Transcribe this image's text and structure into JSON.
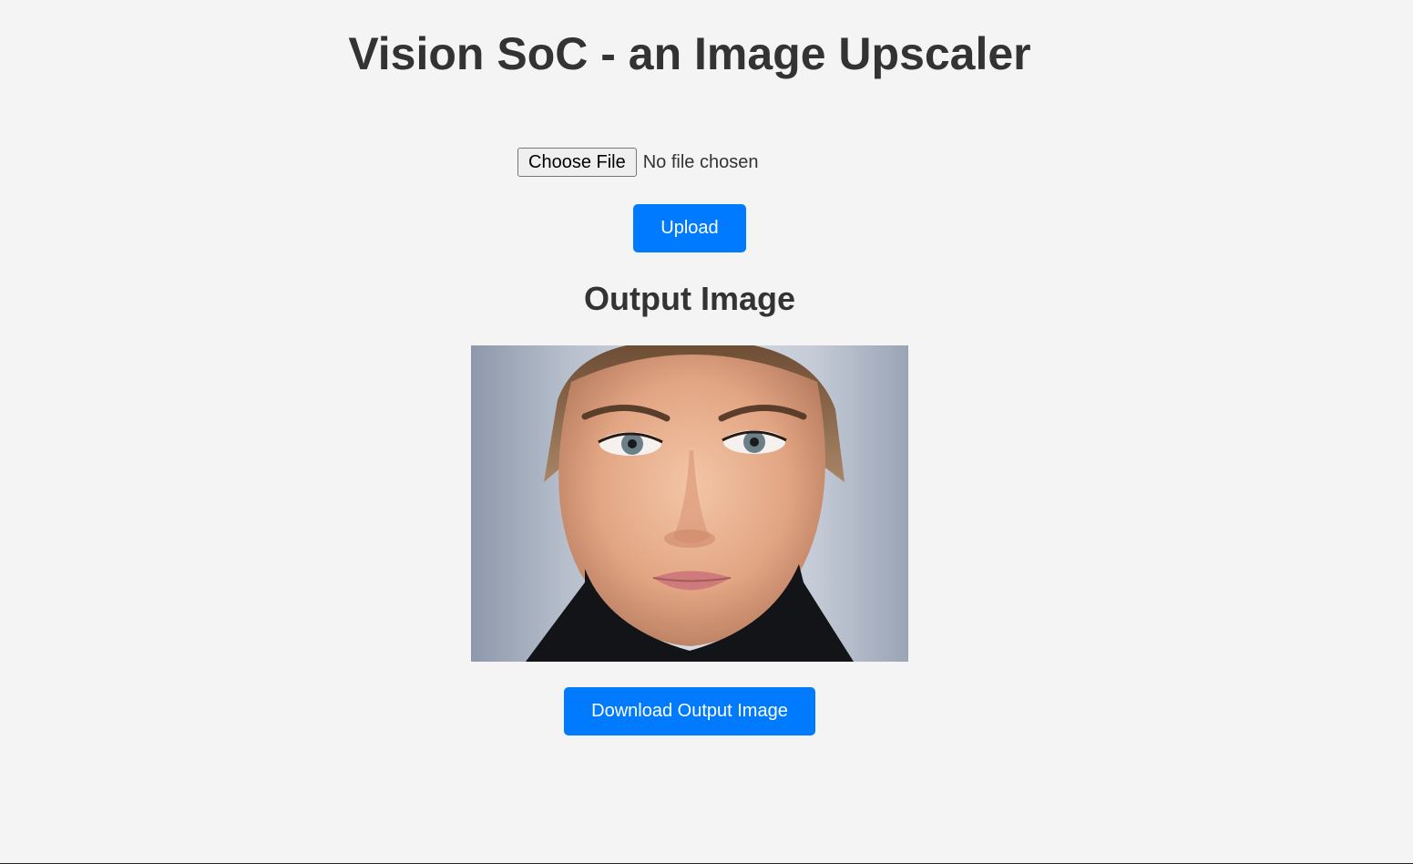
{
  "page": {
    "title": "Vision SoC - an Image Upscaler"
  },
  "upload_form": {
    "choose_file_label": "Choose File",
    "file_status": "No file chosen",
    "upload_label": "Upload"
  },
  "output": {
    "heading": "Output Image",
    "image_alt": "Upscaled output image",
    "download_label": "Download Output Image"
  },
  "colors": {
    "background": "#f4f4f4",
    "text": "#333333",
    "primary_button": "#007bff",
    "primary_button_text": "#ffffff"
  }
}
